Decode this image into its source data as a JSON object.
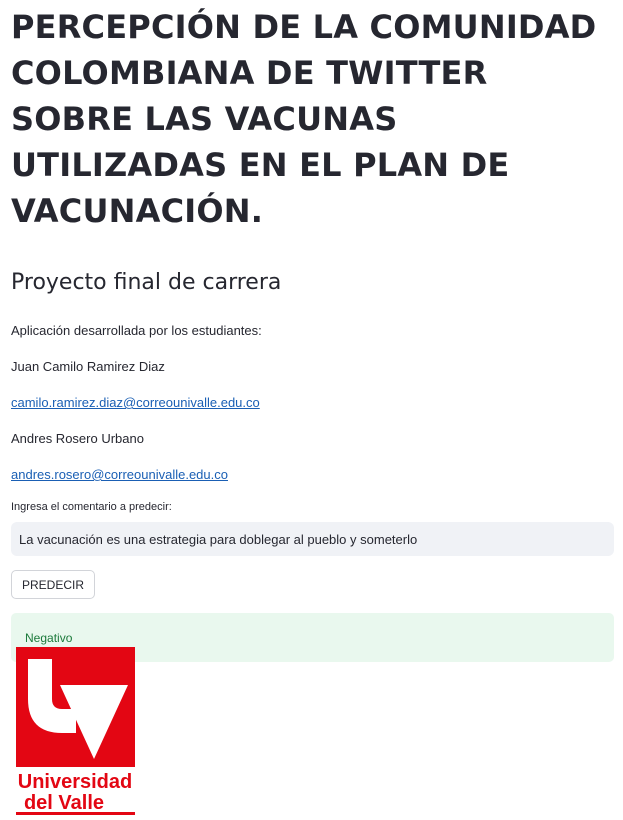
{
  "header": {
    "title": "PERCEPCIÓN DE LA COMUNIDAD COLOMBIANA DE TWITTER SOBRE LAS VACUNAS UTILIZADAS EN EL PLAN DE VACUNACIÓN.",
    "subtitle": "Proyecto final de carrera"
  },
  "authors": {
    "intro": "Aplicación desarrollada por los estudiantes:",
    "author1_name": "Juan Camilo Ramirez Diaz",
    "author1_email": "camilo.ramirez.diaz@correounivalle.edu.co",
    "author2_name": "Andres Rosero Urbano",
    "author2_email": "andres.rosero@correounivalle.edu.co"
  },
  "form": {
    "input_label": "Ingresa el comentario a predecir:",
    "input_value": "La vacunación es una estrategia para doblegar al pueblo y someterlo",
    "button_label": "PREDECIR"
  },
  "result": {
    "text": "Negativo"
  },
  "logo": {
    "line1": "Universidad",
    "line2": "del Valle",
    "color": "#e30613"
  }
}
